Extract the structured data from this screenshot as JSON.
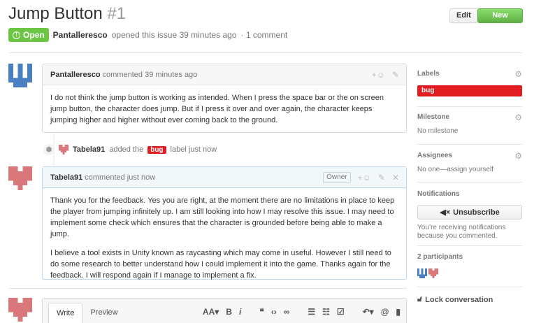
{
  "issue": {
    "title": "Jump Button",
    "number": "#1",
    "state": "Open",
    "author": "Pantalleresco",
    "opened_text": "opened this issue 39 minutes ago",
    "comment_count": "· 1 comment"
  },
  "header_buttons": {
    "edit": "Edit",
    "new_issue": "New issue"
  },
  "comments": [
    {
      "author": "Pantalleresco",
      "meta": "commented 39 minutes ago",
      "paragraphs": [
        "I do not think the jump button is working as intended. When I press the space bar or the on screen jump button, the character does jump. But if I press it over and over again, the character keeps jumping higher and higher without ever coming back to the ground."
      ]
    },
    {
      "author": "Tabela91",
      "meta": "commented just now",
      "badge": "Owner",
      "paragraphs": [
        "Thank you for the feedback. Yes you are right, at the moment there are no limitations in place to keep the player from jumping infinitely up. I am still looking into how I may resolve this issue. I may need to implement some check which ensures that the character is grounded before being able to make a jump.",
        "I believe a tool exists in Unity known as raycasting which may come in useful. However I still need to do some research to better understand how I could implement it into the game. Thanks again for the feedback. I will respond again if I manage to implement a fix."
      ]
    }
  ],
  "event": {
    "actor": "Tabela91",
    "action": "added the",
    "label": "bug",
    "suffix": "label just now"
  },
  "editor": {
    "tab_write": "Write",
    "tab_preview": "Preview"
  },
  "sidebar": {
    "labels_title": "Labels",
    "label_bug": "bug",
    "milestone_title": "Milestone",
    "milestone_value": "No milestone",
    "assignees_title": "Assignees",
    "assignees_value": "No one—assign yourself",
    "notifications_title": "Notifications",
    "unsubscribe": "Unsubscribe",
    "notifications_note": "You’re receiving notifications because you commented.",
    "participants_title": "2 participants",
    "lock": "Lock conversation"
  },
  "colors": {
    "open": "#6cc644",
    "bug": "#e11d21",
    "new_issue": "#60b044",
    "avatar_blue": "#4a7fc1",
    "avatar_red": "#d9777a"
  }
}
